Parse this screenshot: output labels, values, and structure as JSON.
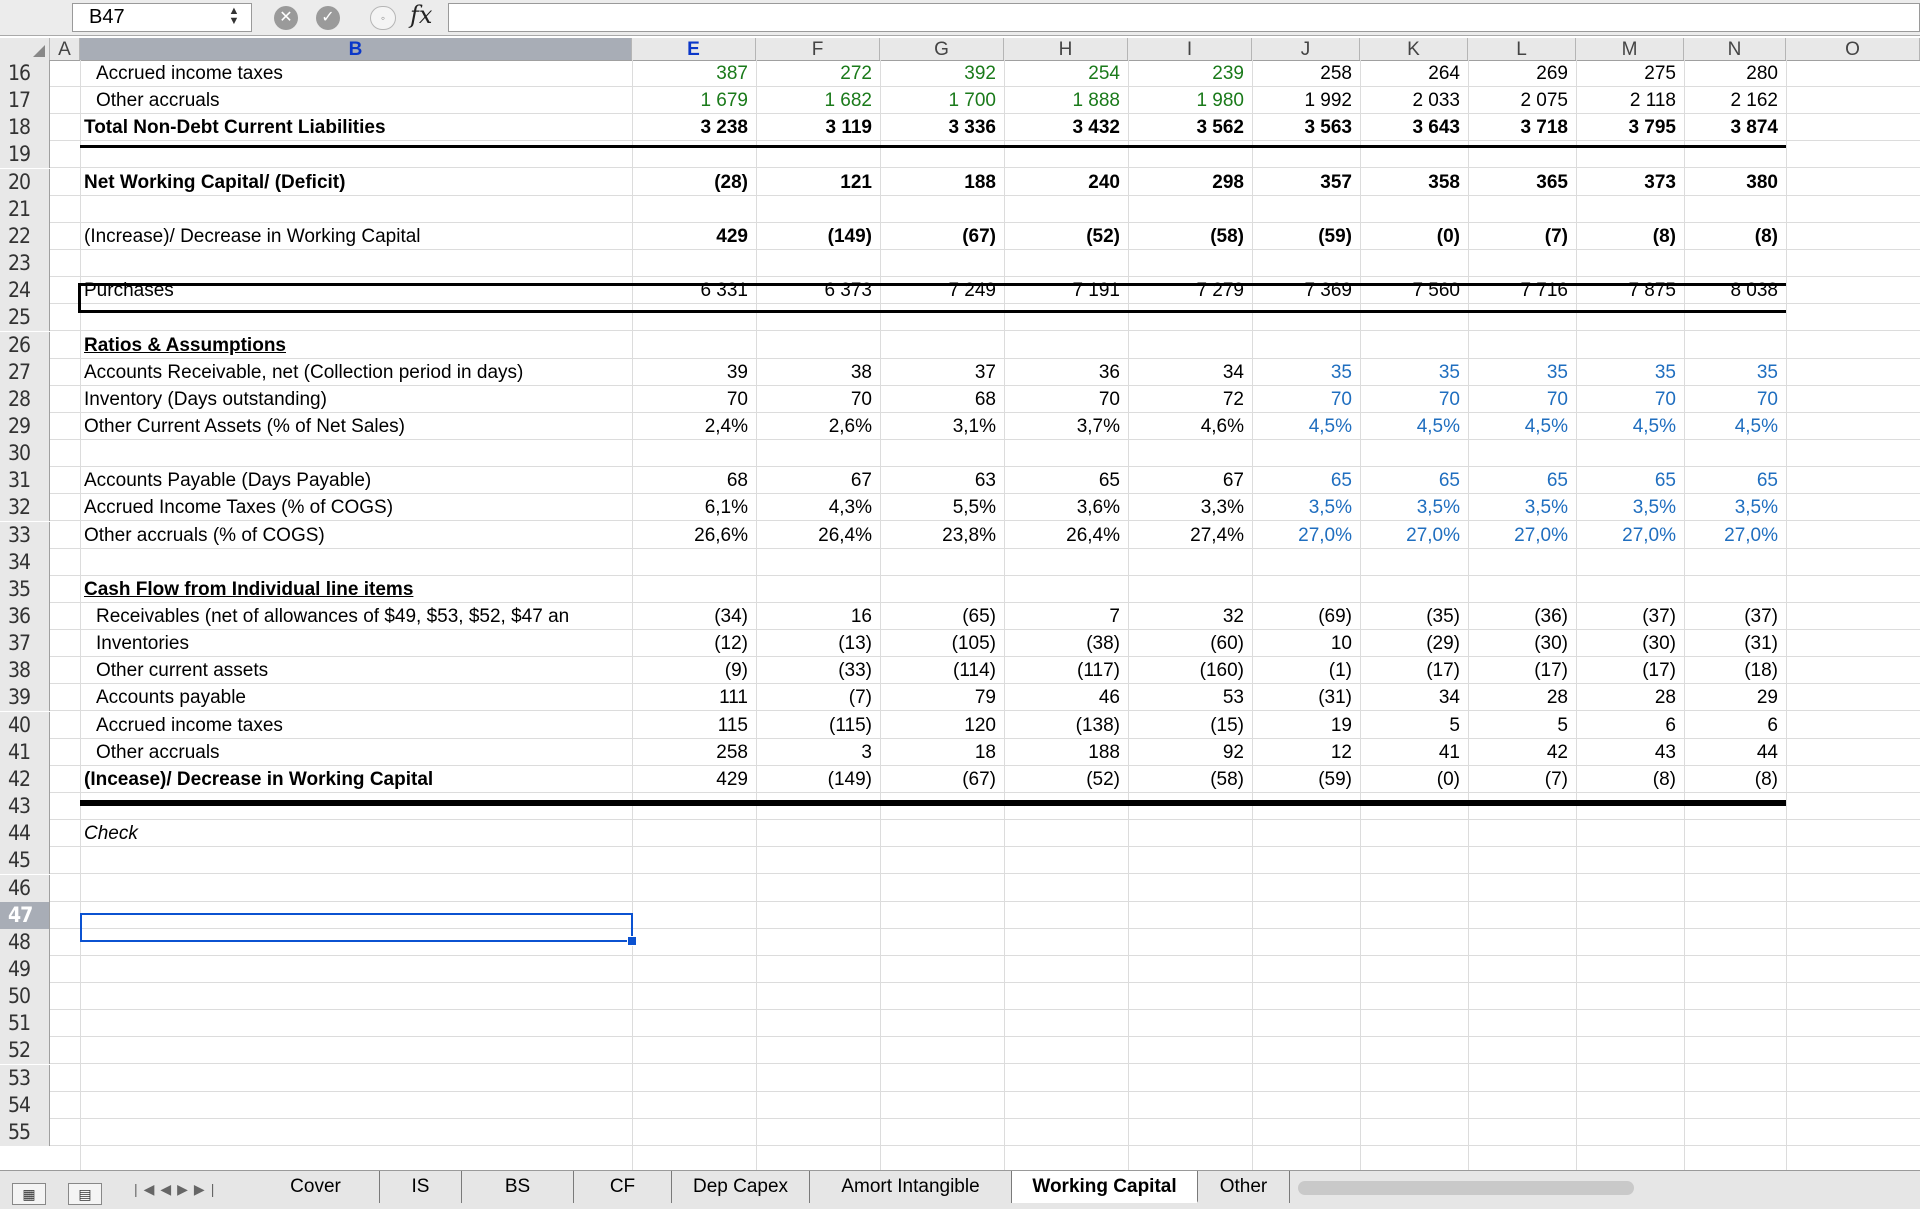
{
  "formula_bar": {
    "name_box": "B47",
    "fx": "fx",
    "formula": ""
  },
  "columns": [
    "A",
    "B",
    "E",
    "F",
    "G",
    "H",
    "I",
    "J",
    "K",
    "L",
    "M",
    "N",
    "O"
  ],
  "rows": [
    {
      "n": "16",
      "label": "Accrued income taxes",
      "indent": true,
      "style": "",
      "values": [
        "387",
        "272",
        "392",
        "254",
        "239",
        "258",
        "264",
        "269",
        "275",
        "280"
      ],
      "colors": [
        "green",
        "green",
        "green",
        "green",
        "green",
        "",
        "",
        "",
        "",
        ""
      ]
    },
    {
      "n": "17",
      "label": "Other accruals",
      "indent": true,
      "style": "",
      "values": [
        "1 679",
        "1 682",
        "1 700",
        "1 888",
        "1 980",
        "1 992",
        "2 033",
        "2 075",
        "2 118",
        "2 162"
      ],
      "colors": [
        "green",
        "green",
        "green",
        "green",
        "green",
        "",
        "",
        "",
        "",
        ""
      ]
    },
    {
      "n": "18",
      "label": "Total Non-Debt Current Liabilities",
      "style": "bold",
      "values": [
        "3 238",
        "3 119",
        "3 336",
        "3 432",
        "3 562",
        "3 563",
        "3 643",
        "3 718",
        "3 795",
        "3 874"
      ]
    },
    {
      "n": "19",
      "label": "",
      "values": []
    },
    {
      "n": "20",
      "label": "Net Working Capital/ (Deficit)",
      "style": "bold",
      "values": [
        "(28)",
        "121",
        "188",
        "240",
        "298",
        "357",
        "358",
        "365",
        "373",
        "380"
      ]
    },
    {
      "n": "21",
      "label": "",
      "values": []
    },
    {
      "n": "22",
      "label": "(Increase)/ Decrease in Working Capital",
      "style": "",
      "values": [
        "429",
        "(149)",
        "(67)",
        "(52)",
        "(58)",
        "(59)",
        "(0)",
        "(7)",
        "(8)",
        "(8)"
      ],
      "bold_values": true
    },
    {
      "n": "23",
      "label": "",
      "values": []
    },
    {
      "n": "24",
      "label": "Purchases",
      "style": "",
      "values": [
        "6 331",
        "6 373",
        "7 249",
        "7 191",
        "7 279",
        "7 369",
        "7 560",
        "7 716",
        "7 875",
        "8 038"
      ]
    },
    {
      "n": "25",
      "label": "",
      "values": []
    },
    {
      "n": "26",
      "label": "Ratios & Assumptions",
      "style": "bold ul",
      "values": []
    },
    {
      "n": "27",
      "label": "Accounts Receivable, net (Collection period in days)",
      "style": "",
      "values": [
        "39",
        "38",
        "37",
        "36",
        "34",
        "35",
        "35",
        "35",
        "35",
        "35"
      ],
      "colors": [
        "",
        "",
        "",
        "",
        "",
        "blue",
        "blue",
        "blue",
        "blue",
        "blue"
      ]
    },
    {
      "n": "28",
      "label": "Inventory (Days outstanding)",
      "style": "",
      "values": [
        "70",
        "70",
        "68",
        "70",
        "72",
        "70",
        "70",
        "70",
        "70",
        "70"
      ],
      "colors": [
        "",
        "",
        "",
        "",
        "",
        "blue",
        "blue",
        "blue",
        "blue",
        "blue"
      ]
    },
    {
      "n": "29",
      "label": "Other Current Assets (% of Net Sales)",
      "style": "",
      "values": [
        "2,4%",
        "2,6%",
        "3,1%",
        "3,7%",
        "4,6%",
        "4,5%",
        "4,5%",
        "4,5%",
        "4,5%",
        "4,5%"
      ],
      "colors": [
        "",
        "",
        "",
        "",
        "",
        "blue",
        "blue",
        "blue",
        "blue",
        "blue"
      ]
    },
    {
      "n": "30",
      "label": "",
      "values": []
    },
    {
      "n": "31",
      "label": "Accounts Payable (Days Payable)",
      "style": "",
      "values": [
        "68",
        "67",
        "63",
        "65",
        "67",
        "65",
        "65",
        "65",
        "65",
        "65"
      ],
      "colors": [
        "",
        "",
        "",
        "",
        "",
        "blue",
        "blue",
        "blue",
        "blue",
        "blue"
      ]
    },
    {
      "n": "32",
      "label": "Accrued Income Taxes (% of COGS)",
      "style": "",
      "values": [
        "6,1%",
        "4,3%",
        "5,5%",
        "3,6%",
        "3,3%",
        "3,5%",
        "3,5%",
        "3,5%",
        "3,5%",
        "3,5%"
      ],
      "colors": [
        "",
        "",
        "",
        "",
        "",
        "blue",
        "blue",
        "blue",
        "blue",
        "blue"
      ]
    },
    {
      "n": "33",
      "label": "Other accruals (% of COGS)",
      "style": "",
      "values": [
        "26,6%",
        "26,4%",
        "23,8%",
        "26,4%",
        "27,4%",
        "27,0%",
        "27,0%",
        "27,0%",
        "27,0%",
        "27,0%"
      ],
      "colors": [
        "",
        "",
        "",
        "",
        "",
        "blue",
        "blue",
        "blue",
        "blue",
        "blue"
      ]
    },
    {
      "n": "34",
      "label": "",
      "values": []
    },
    {
      "n": "35",
      "label": "Cash Flow from Individual line items",
      "style": "bold ul",
      "values": []
    },
    {
      "n": "36",
      "label": "Receivables (net of allowances of $49, $53, $52, $47 an",
      "indent": true,
      "style": "",
      "values": [
        "(34)",
        "16",
        "(65)",
        "7",
        "32",
        "(69)",
        "(35)",
        "(36)",
        "(37)",
        "(37)"
      ]
    },
    {
      "n": "37",
      "label": "Inventories",
      "indent": true,
      "style": "",
      "values": [
        "(12)",
        "(13)",
        "(105)",
        "(38)",
        "(60)",
        "10",
        "(29)",
        "(30)",
        "(30)",
        "(31)"
      ]
    },
    {
      "n": "38",
      "label": "Other current assets",
      "indent": true,
      "style": "",
      "values": [
        "(9)",
        "(33)",
        "(114)",
        "(117)",
        "(160)",
        "(1)",
        "(17)",
        "(17)",
        "(17)",
        "(18)"
      ]
    },
    {
      "n": "39",
      "label": "Accounts payable",
      "indent": true,
      "style": "",
      "values": [
        "111",
        "(7)",
        "79",
        "46",
        "53",
        "(31)",
        "34",
        "28",
        "28",
        "29"
      ]
    },
    {
      "n": "40",
      "label": "Accrued income taxes",
      "indent": true,
      "style": "",
      "values": [
        "115",
        "(115)",
        "120",
        "(138)",
        "(15)",
        "19",
        "5",
        "5",
        "6",
        "6"
      ]
    },
    {
      "n": "41",
      "label": "Other accruals",
      "indent": true,
      "style": "",
      "values": [
        "258",
        "3",
        "18",
        "188",
        "92",
        "12",
        "41",
        "42",
        "43",
        "44"
      ]
    },
    {
      "n": "42",
      "label": "(Incease)/ Decrease in Working Capital",
      "style": "bold",
      "values": [
        "429",
        "(149)",
        "(67)",
        "(52)",
        "(58)",
        "(59)",
        "(0)",
        "(7)",
        "(8)",
        "(8)"
      ],
      "plain_values": true
    },
    {
      "n": "43",
      "label": "",
      "values": []
    },
    {
      "n": "44",
      "label": "Check",
      "style": "ital",
      "values": []
    },
    {
      "n": "45",
      "label": "",
      "values": []
    },
    {
      "n": "46",
      "label": "",
      "values": []
    },
    {
      "n": "47",
      "label": "",
      "values": []
    },
    {
      "n": "48",
      "label": "",
      "values": []
    },
    {
      "n": "49",
      "label": "",
      "values": []
    },
    {
      "n": "50",
      "label": "",
      "values": []
    },
    {
      "n": "51",
      "label": "",
      "values": []
    },
    {
      "n": "52",
      "label": "",
      "values": []
    },
    {
      "n": "53",
      "label": "",
      "values": []
    },
    {
      "n": "54",
      "label": "",
      "values": []
    },
    {
      "n": "55",
      "label": "",
      "values": []
    }
  ],
  "selected_cell": "B47",
  "sheet_tabs": [
    "Cover",
    "IS",
    "BS",
    "CF",
    "Dep Capex",
    "Amort Intangible",
    "Working Capital",
    "Other"
  ],
  "active_tab": "Working Capital",
  "colors": {
    "selection": "#0b52d1",
    "input_blue": "#1f6ebf",
    "history_green": "#1a7a1a"
  }
}
